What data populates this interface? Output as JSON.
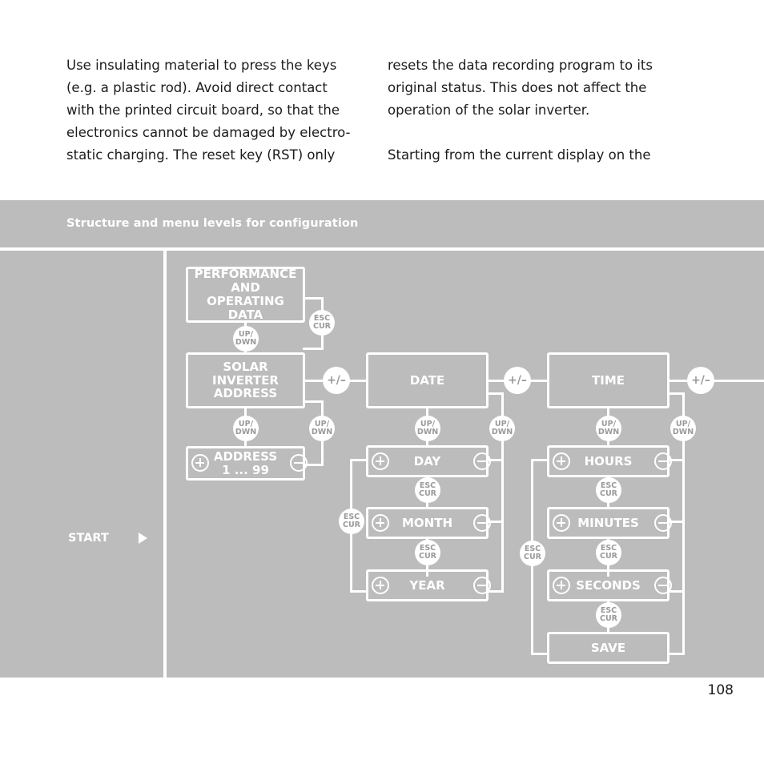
{
  "body_text": {
    "left_column": [
      "Use insulating material to press the keys (e.g. a plastic rod). Avoid direct contact with the printed circuit board, so that the electronics cannot be damaged by electro-static charging. The reset key (RST) only"
    ],
    "right_column": [
      "resets the data recording program to its original status. This does not affect the operation of the solar inverter.",
      "Starting from the current display on the"
    ]
  },
  "diagram": {
    "title": "Structure and menu levels for configuration",
    "start_label": "START",
    "nodes": {
      "performance": "PERFORMANCE\nAND\nOPERATING DATA",
      "performance_line1": "PERFORMANCE",
      "performance_line2": "AND",
      "performance_line3": "OPERATING DATA",
      "solar_inverter_line1": "SOLAR INVERTER",
      "solar_inverter_line2": "ADDRESS",
      "address_line1": "ADDRESS",
      "address_line2": "1 ... 99",
      "date": "DATE",
      "day": "DAY",
      "month": "MONTH",
      "year": "YEAR",
      "time": "TIME",
      "hours": "HOURS",
      "minutes": "MINUTES",
      "seconds": "SECONDS",
      "save": "SAVE"
    },
    "connectors": {
      "updwn_top": "UP/",
      "updwn_bottom": "DWN",
      "esc_top": "ESC",
      "esc_bottom": "CUR",
      "plus_minus": "+/–"
    }
  },
  "page_number": "108",
  "colors": {
    "band_background": "#bcbcbc",
    "stroke": "#ffffff",
    "chip_text": "#9a9a9a",
    "body_text": "#1c1c1c"
  }
}
